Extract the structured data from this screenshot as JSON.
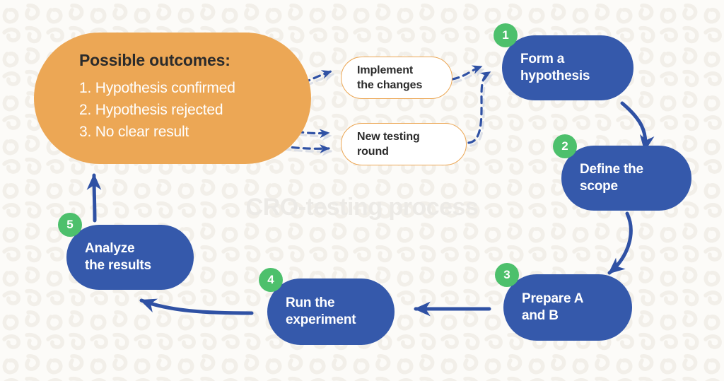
{
  "diagram": {
    "watermark_title": "CRO-testing process",
    "colors": {
      "blue": "#3559ab",
      "orange": "#eca755",
      "green": "#4dc06c",
      "background": "#fcfbf8",
      "watermark": "#eceae6"
    }
  },
  "outcomes_panel": {
    "title": "Possible outcomes:",
    "items": [
      "1. Hypothesis confirmed",
      "2. Hypothesis rejected",
      "3. No clear result"
    ]
  },
  "action_boxes": [
    {
      "label": "Implement\nthe changes",
      "line1": "Implement",
      "line2": "the changes"
    },
    {
      "label": "New testing\nround",
      "line1": "New testing",
      "line2": "round"
    }
  ],
  "steps": [
    {
      "number": "1",
      "line1": "Form a",
      "line2": "hypothesis"
    },
    {
      "number": "2",
      "line1": "Define the",
      "line2": "scope"
    },
    {
      "number": "3",
      "line1": "Prepare A",
      "line2": "and B"
    },
    {
      "number": "4",
      "line1": "Run the",
      "line2": "experiment"
    },
    {
      "number": "5",
      "line1": "Analyze",
      "line2": "the results"
    }
  ]
}
